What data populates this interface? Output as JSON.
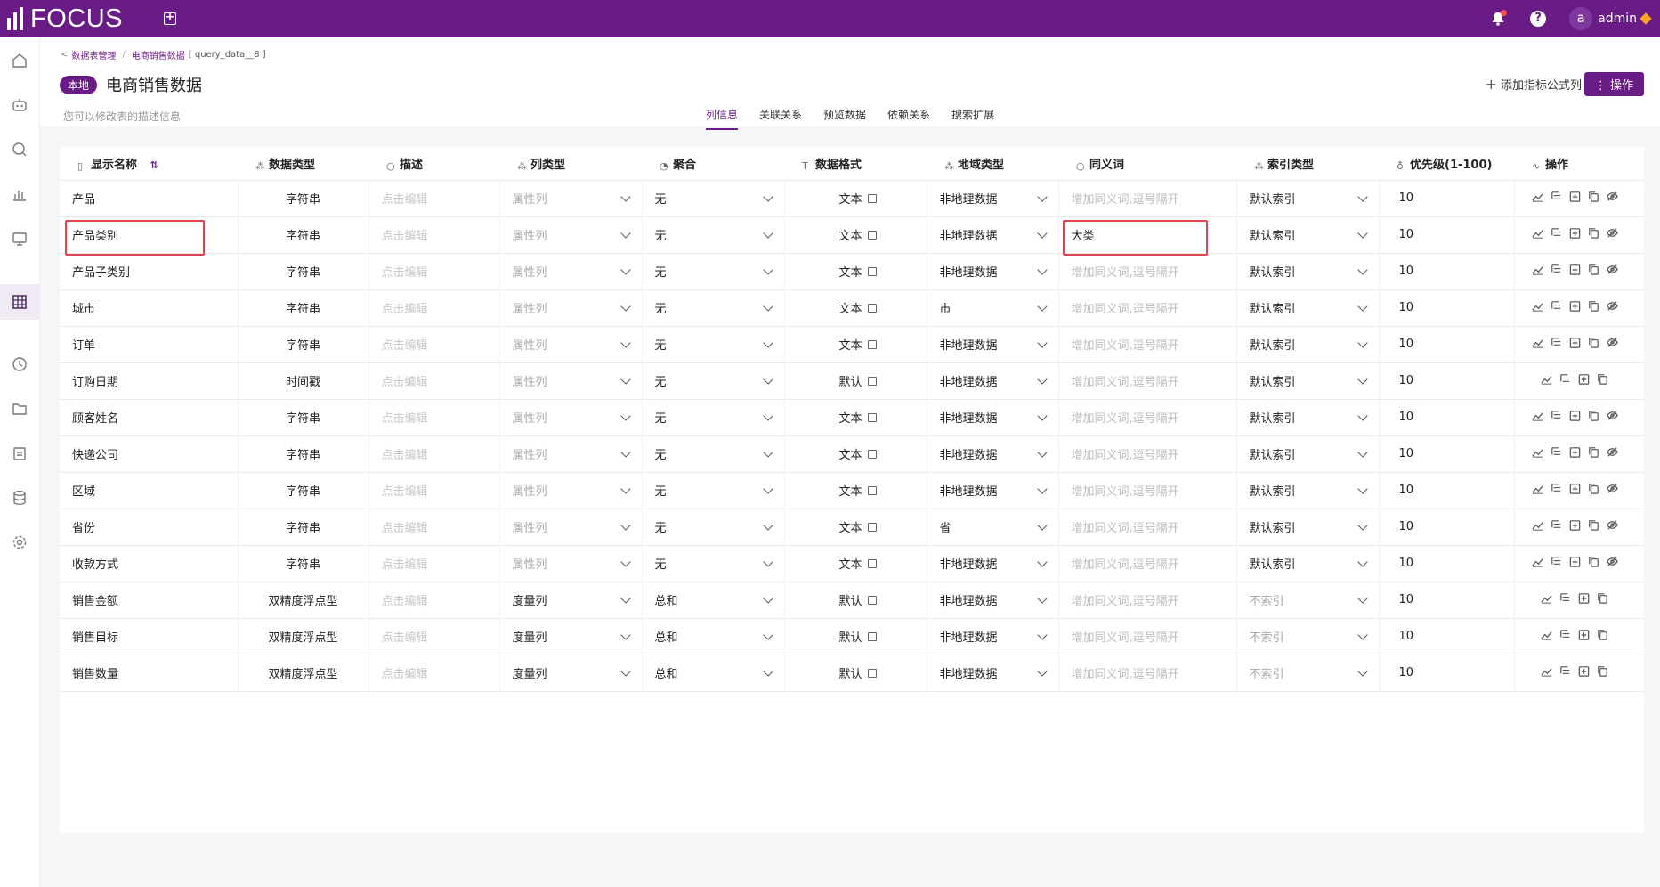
{
  "app": {
    "logo_text": "FOCUS",
    "user": "admin",
    "user_initial": "a"
  },
  "colors": {
    "brand": "#6a1c86",
    "highlight": "#e0444b"
  },
  "sidebar_icons": [
    "home-icon",
    "robot-icon",
    "search-icon",
    "chart-icon",
    "board-icon",
    "table-icon",
    "history-icon",
    "folder-icon",
    "clipboard-icon",
    "database-icon",
    "gear-icon"
  ],
  "breadcrumb": {
    "parent": "数据表管理",
    "current": "电商销售数据",
    "suffix": "[ query_data__8 ]"
  },
  "header": {
    "badge": "本地",
    "title": "电商销售数据",
    "desc_hint": "您可以修改表的描述信息",
    "add_formula": "添加指标公式列",
    "ops_button": "操作"
  },
  "tabs": [
    "列信息",
    "关联关系",
    "预览数据",
    "依赖关系",
    "搜索扩展"
  ],
  "columns": [
    "显示名称",
    "数据类型",
    "描述",
    "列类型",
    "聚合",
    "数据格式",
    "地域类型",
    "同义词",
    "索引类型",
    "优先级(1-100)",
    "操作"
  ],
  "desc_placeholder": "点击编辑",
  "syn_placeholder": "增加同义词,逗号隔开",
  "rows": [
    {
      "name": "产品",
      "type": "字符串",
      "coltype": "属性列",
      "agg": "无",
      "fmt": "文本",
      "geo": "非地理数据",
      "syn": "",
      "idx": "默认索引",
      "pri": "10",
      "hide": true
    },
    {
      "name": "产品类别",
      "type": "字符串",
      "coltype": "属性列",
      "agg": "无",
      "fmt": "文本",
      "geo": "非地理数据",
      "syn": "大类",
      "idx": "默认索引",
      "pri": "10",
      "hide": true
    },
    {
      "name": "产品子类别",
      "type": "字符串",
      "coltype": "属性列",
      "agg": "无",
      "fmt": "文本",
      "geo": "非地理数据",
      "syn": "",
      "idx": "默认索引",
      "pri": "10",
      "hide": true
    },
    {
      "name": "城市",
      "type": "字符串",
      "coltype": "属性列",
      "agg": "无",
      "fmt": "文本",
      "geo": "市",
      "syn": "",
      "idx": "默认索引",
      "pri": "10",
      "hide": true
    },
    {
      "name": "订单",
      "type": "字符串",
      "coltype": "属性列",
      "agg": "无",
      "fmt": "文本",
      "geo": "非地理数据",
      "syn": "",
      "idx": "默认索引",
      "pri": "10",
      "hide": true
    },
    {
      "name": "订购日期",
      "type": "时间戳",
      "coltype": "属性列",
      "agg": "无",
      "fmt": "默认",
      "geo": "非地理数据",
      "syn": "",
      "idx": "默认索引",
      "pri": "10",
      "hide": false
    },
    {
      "name": "顾客姓名",
      "type": "字符串",
      "coltype": "属性列",
      "agg": "无",
      "fmt": "文本",
      "geo": "非地理数据",
      "syn": "",
      "idx": "默认索引",
      "pri": "10",
      "hide": true
    },
    {
      "name": "快递公司",
      "type": "字符串",
      "coltype": "属性列",
      "agg": "无",
      "fmt": "文本",
      "geo": "非地理数据",
      "syn": "",
      "idx": "默认索引",
      "pri": "10",
      "hide": true
    },
    {
      "name": "区域",
      "type": "字符串",
      "coltype": "属性列",
      "agg": "无",
      "fmt": "文本",
      "geo": "非地理数据",
      "syn": "",
      "idx": "默认索引",
      "pri": "10",
      "hide": true
    },
    {
      "name": "省份",
      "type": "字符串",
      "coltype": "属性列",
      "agg": "无",
      "fmt": "文本",
      "geo": "省",
      "syn": "",
      "idx": "默认索引",
      "pri": "10",
      "hide": true
    },
    {
      "name": "收款方式",
      "type": "字符串",
      "coltype": "属性列",
      "agg": "无",
      "fmt": "文本",
      "geo": "非地理数据",
      "syn": "",
      "idx": "默认索引",
      "pri": "10",
      "hide": true
    },
    {
      "name": "销售金额",
      "type": "双精度浮点型",
      "coltype": "度量列",
      "agg": "总和",
      "fmt": "默认",
      "geo": "非地理数据",
      "syn": "",
      "idx": "不索引",
      "pri": "10",
      "hide": false
    },
    {
      "name": "销售目标",
      "type": "双精度浮点型",
      "coltype": "度量列",
      "agg": "总和",
      "fmt": "默认",
      "geo": "非地理数据",
      "syn": "",
      "idx": "不索引",
      "pri": "10",
      "hide": false
    },
    {
      "name": "销售数量",
      "type": "双精度浮点型",
      "coltype": "度量列",
      "agg": "总和",
      "fmt": "默认",
      "geo": "非地理数据",
      "syn": "",
      "idx": "不索引",
      "pri": "10",
      "hide": false
    }
  ]
}
